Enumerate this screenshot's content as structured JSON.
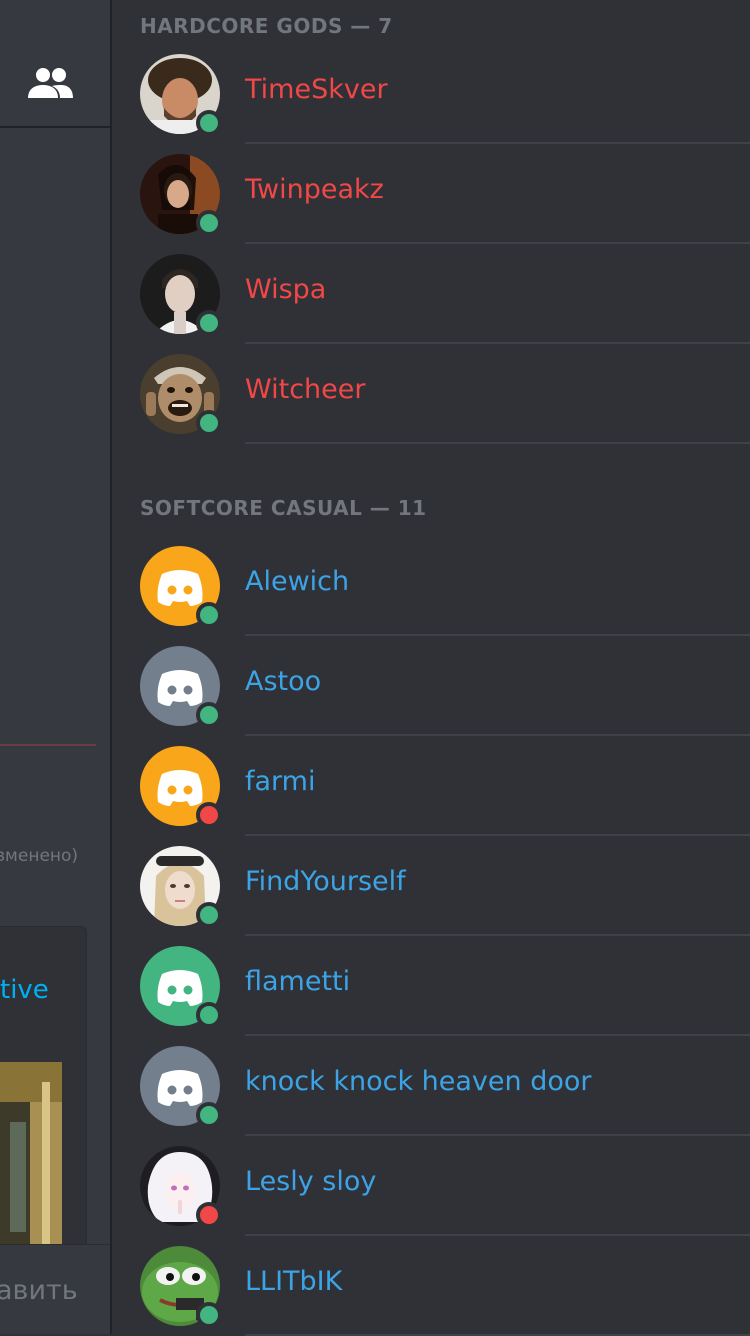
{
  "left_panel": {
    "edited_text": "зменено)",
    "embed_link_text": "tive",
    "input_placeholder": "авить"
  },
  "colors": {
    "role_hardcore": "#f04747",
    "role_softcore": "#3ca4e6",
    "online": "#43b581",
    "dnd": "#f04747",
    "orange_avatar": "#faa61a",
    "grey_avatar": "#747f8d",
    "green_avatar": "#43b581"
  },
  "sections": [
    {
      "header": "HARDCORE GODS — 7",
      "members": [
        {
          "name": "TimeSkver",
          "status": "online",
          "avatar": "photo-bob"
        },
        {
          "name": "Twinpeakz",
          "status": "online",
          "avatar": "photo-twinpeaks"
        },
        {
          "name": "Wispa",
          "status": "online",
          "avatar": "photo-man"
        },
        {
          "name": "Witcheer",
          "status": "online",
          "avatar": "photo-laughing"
        }
      ]
    },
    {
      "header": "SOFTCORE CASUAL — 11",
      "members": [
        {
          "name": "Alewich",
          "status": "online",
          "avatar": "discord-orange"
        },
        {
          "name": "Astoo",
          "status": "online",
          "avatar": "discord-grey"
        },
        {
          "name": "farmi",
          "status": "dnd",
          "avatar": "discord-orange"
        },
        {
          "name": "FindYourself",
          "status": "online",
          "avatar": "photo-woman"
        },
        {
          "name": "flametti",
          "status": "online",
          "avatar": "discord-green"
        },
        {
          "name": "knock knock heaven door",
          "status": "online",
          "avatar": "discord-grey"
        },
        {
          "name": "Lesly sloy",
          "status": "dnd",
          "avatar": "anime-girl"
        },
        {
          "name": "LLITbIK",
          "status": "online",
          "avatar": "pepe"
        }
      ]
    }
  ]
}
